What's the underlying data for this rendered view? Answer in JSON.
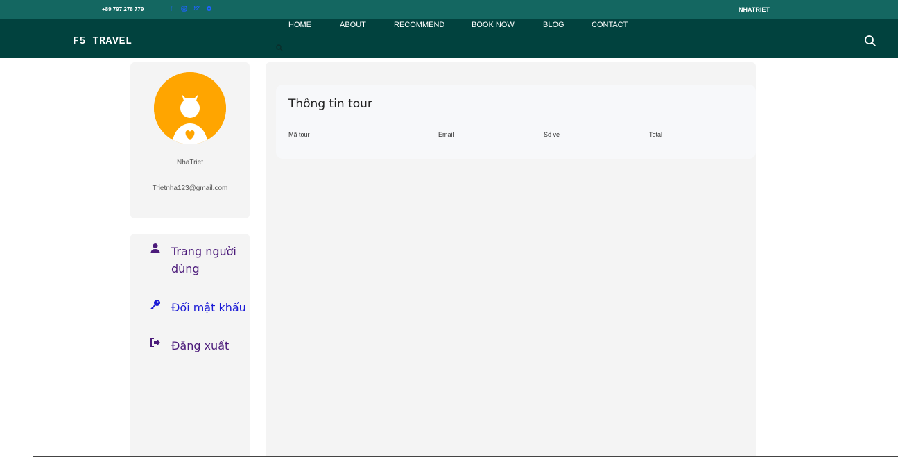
{
  "topbar": {
    "phone": "+89 797 278 779",
    "socials": [
      "facebook-icon",
      "instagram-icon",
      "twitter-icon",
      "pinterest-icon"
    ],
    "username": "NHATRIET"
  },
  "navbar": {
    "brand": "F5 TRAVEL",
    "links": [
      "HOME",
      "ABOUT",
      "RECOMMEND",
      "BOOK NOW",
      "BLOG",
      "CONTACT"
    ]
  },
  "profile": {
    "name": "NhaTriet",
    "email": "Trietnha123@gmail.com",
    "avatar_color": "#ffa500"
  },
  "menu": {
    "items": [
      {
        "label": "Trang người dùng",
        "icon": "user-icon",
        "color": "#4b1a7a"
      },
      {
        "label": "Đổi mật khẩu",
        "icon": "key-icon",
        "color": "#1a1ad6"
      },
      {
        "label": "Đăng xuất",
        "icon": "sign-out-icon",
        "color": "#4b1a7a"
      }
    ]
  },
  "tour": {
    "title": "Thông tin tour",
    "columns": [
      "Mã tour",
      "Email",
      "Số vé",
      "Total"
    ]
  },
  "colors": {
    "topbar": "#146761",
    "navbar": "#01423e",
    "panel": "#f4f4f4"
  }
}
